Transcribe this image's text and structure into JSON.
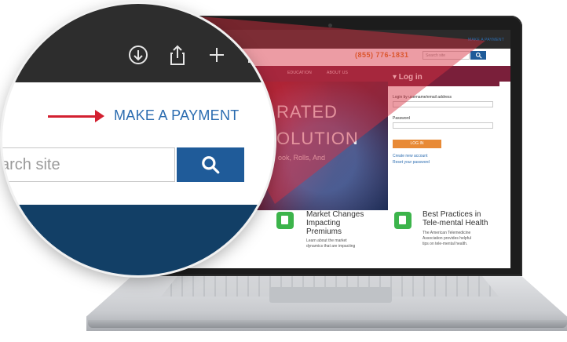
{
  "payment": {
    "link_label": "MAKE A PAYMENT"
  },
  "search": {
    "placeholder": "arch site",
    "button_icon": "search-icon"
  },
  "header": {
    "phone": "(855) 776-1831",
    "search_placeholder": "Search site",
    "nav": [
      "EDUCATION",
      "ABOUT US"
    ]
  },
  "hero": {
    "line1": "RATED",
    "line2": "OLUTION",
    "subline": "ook, Rolls, And"
  },
  "login": {
    "title": "▾ Log in",
    "username_label": "Login by username/email address",
    "password_label": "Password",
    "button_label": "LOG IN",
    "create_account": "Create new account",
    "reset_password": "Reset your password"
  },
  "cards": [
    {
      "title_line1": "Market Changes",
      "title_line2": "Impacting",
      "title_line3": "Premiums",
      "text_line1": "Learn about the market",
      "text_line2": "dynamics that are impacting"
    },
    {
      "title_line1": "Best Practices in",
      "title_line2": "Tele-mental Health",
      "text_line1": "The American Telemedicine",
      "text_line2": "Association provides helpful",
      "text_line3": "tips on tele-mental health."
    }
  ],
  "browser_toolbar": {
    "icons": [
      "download-icon",
      "share-icon",
      "new-tab-icon",
      "tabs-icon"
    ]
  },
  "colors": {
    "accent_blue": "#1f5b99",
    "link_blue": "#2b6cb0",
    "arrow_red": "#d32030",
    "brand_maroon": "#7a1f3a",
    "orange": "#e07a1f",
    "green": "#3cb44b"
  }
}
